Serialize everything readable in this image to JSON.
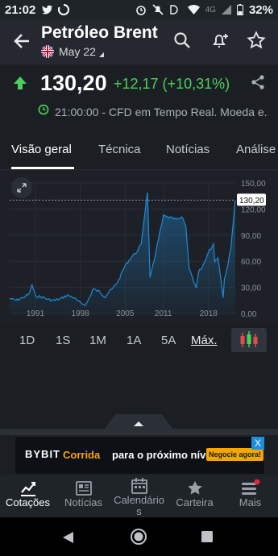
{
  "status_bar": {
    "time": "21:02",
    "battery": "32%",
    "network": "4G"
  },
  "header": {
    "title": "Petróleo Brent",
    "contract": "May 22"
  },
  "quote": {
    "price": "130,20",
    "change": "+12,17 (+10,31%)",
    "timestamp": "21:00:00",
    "description": "- CFD em Tempo Real. Moeda e..."
  },
  "tabs": [
    "Visão geral",
    "Técnica",
    "Notícias",
    "Análise"
  ],
  "ranges": [
    "1D",
    "1S",
    "1M",
    "1A",
    "5A",
    "Máx."
  ],
  "active_range": "Máx.",
  "chart_data": {
    "type": "area",
    "x": [
      1987,
      1988,
      1989,
      1990,
      1990.5,
      1991,
      1992,
      1993,
      1994,
      1995,
      1996,
      1997,
      1998,
      1998.9,
      1999.5,
      2000,
      2001,
      2001.9,
      2002.5,
      2003,
      2004,
      2005,
      2006,
      2007,
      2007.5,
      2008.5,
      2008.9,
      2009.5,
      2010,
      2011,
      2012,
      2013,
      2014,
      2014.5,
      2015,
      2016.1,
      2016.5,
      2017,
      2018,
      2018.8,
      2019,
      2019.5,
      2020.3,
      2020.5,
      2021,
      2021.5,
      2022.2
    ],
    "y": [
      17,
      15,
      18,
      22,
      33,
      20,
      19,
      16,
      15,
      17,
      21,
      18,
      12,
      10,
      19,
      28,
      25,
      19,
      25,
      28,
      38,
      55,
      65,
      72,
      80,
      140,
      40,
      60,
      78,
      112,
      110,
      108,
      110,
      100,
      52,
      28,
      48,
      52,
      70,
      80,
      60,
      65,
      19,
      40,
      55,
      75,
      130.2
    ],
    "yticks": [
      "0,00",
      "30,00",
      "60,00",
      "90,00",
      "120,00",
      "150,00"
    ],
    "ylim": [
      0,
      150
    ],
    "xticks": [
      "1991",
      "1998",
      "2005",
      "2011",
      "2018"
    ],
    "last_value_label": "130,20",
    "color": "#1e8ad6"
  },
  "ad": {
    "brand": "BYBIT",
    "text_highlight": "Corrida",
    "text": "para o próximo nível",
    "cta": "Negocie agora!",
    "close": "X"
  },
  "bottom_nav": [
    {
      "label": "Cotações"
    },
    {
      "label": "Notícias"
    },
    {
      "label": "Calendário\ns"
    },
    {
      "label": "Carteira"
    },
    {
      "label": "Mais"
    }
  ],
  "colors": {
    "positive": "#4cd05a",
    "accent": "#1e8ad6"
  }
}
